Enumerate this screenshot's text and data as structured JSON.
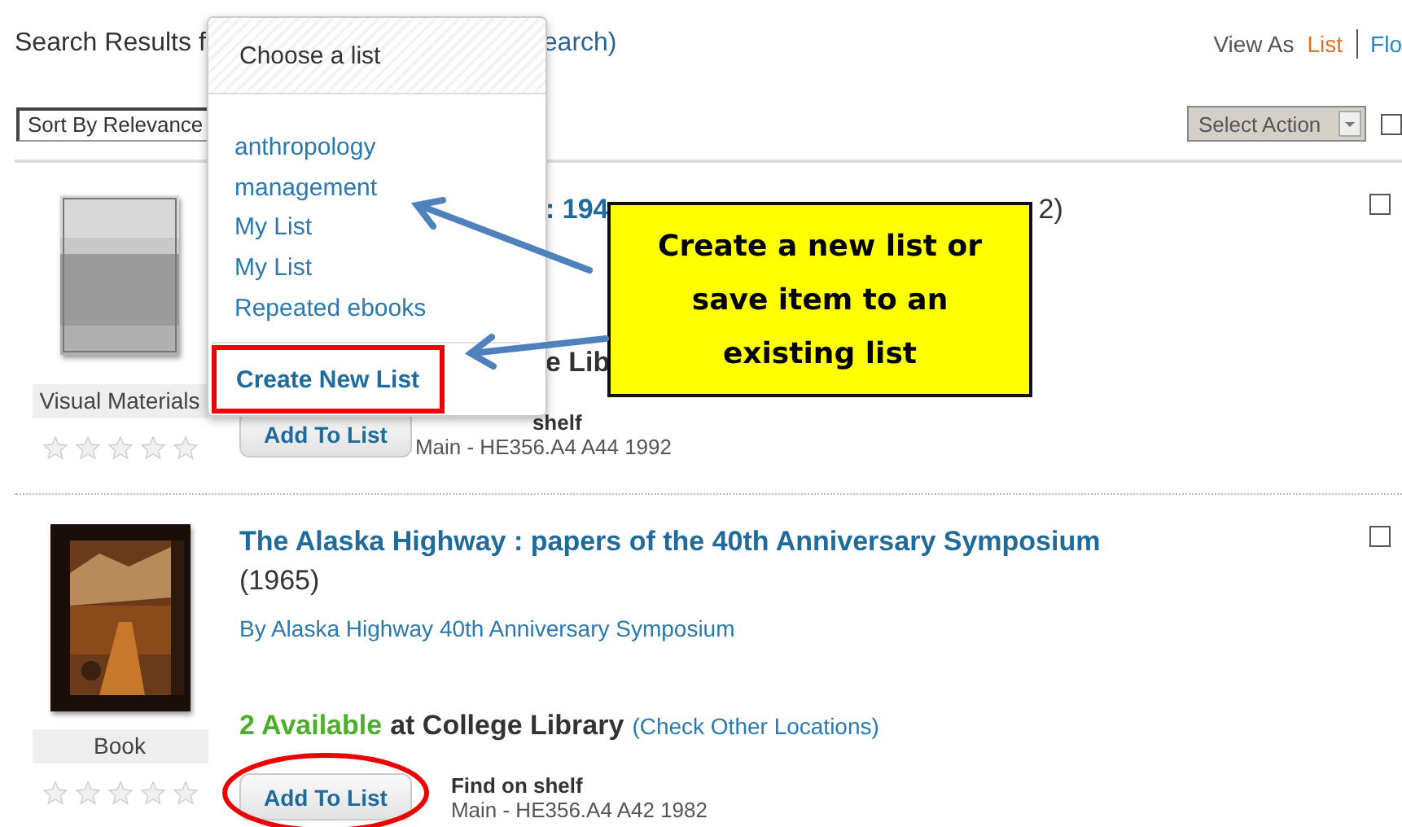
{
  "header": {
    "results_fragment": "Search Results f",
    "search_fragment": "earch)",
    "view_as_label": "View As",
    "view_options": [
      {
        "label": "List",
        "selected": true
      },
      {
        "label": "Flo",
        "selected": false
      }
    ]
  },
  "toolbar": {
    "sort_select": "Sort By Relevance",
    "action_select": "Select Action",
    "select_all_checked": false
  },
  "results": [
    {
      "kind": "partial",
      "format": "Visual Materials",
      "stars": 0,
      "title_fragments": [
        ": 194",
        "2)"
      ],
      "availability_fragment": "e Lib",
      "shelf_label": "shelf",
      "call_number": "Main - HE356.A4 A44 1992",
      "add_button": "Add To List",
      "checked": false
    },
    {
      "kind": "full",
      "format": "Book",
      "stars": 0,
      "title": "The Alaska Highway : papers of the 40th Anniversary Symposium",
      "year": "(1965)",
      "author": "By Alaska Highway 40th Anniversary Symposium",
      "available": "2 Available",
      "location": "at College Library",
      "other_locations": "(Check Other Locations)",
      "shelf_label": "Find on shelf",
      "call_number": "Main - HE356.A4 A42 1982",
      "add_button": "Add To List",
      "checked": false
    }
  ],
  "list_menu": {
    "title": "Choose a list",
    "lists": [
      "anthropology",
      "management",
      "My List",
      "My List",
      "Repeated ebooks"
    ],
    "create_button": "Create New List"
  },
  "callout": {
    "text": "Create a new list or save item to an existing list"
  }
}
